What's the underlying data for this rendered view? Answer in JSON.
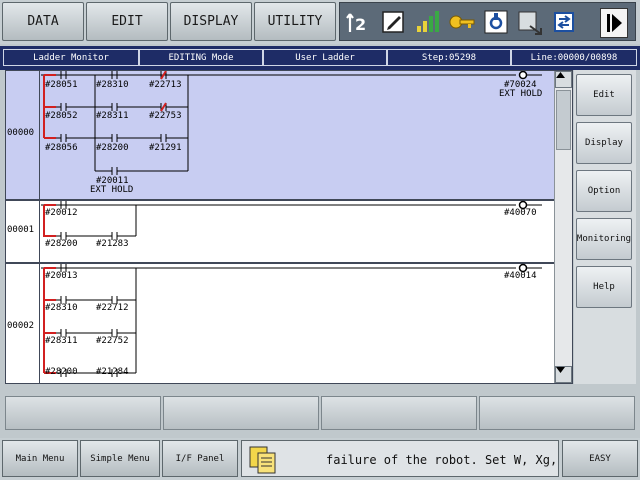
{
  "top_menu": {
    "items": [
      "DATA",
      "EDIT",
      "DISPLAY",
      "UTILITY"
    ]
  },
  "toolbar_icons": [
    "coordinate-toggle-icon",
    "edit-pencil-icon",
    "signal-strength-icon",
    "key-icon",
    "tool-icon",
    "exit-window-icon",
    "convert-icon",
    "next-page-icon"
  ],
  "status_bar": {
    "mode": "Ladder Monitor",
    "edit_mode": "EDITING Mode",
    "ladder_type": "User Ladder",
    "step": "Step:05298",
    "line": "Line:00000/00898"
  },
  "rungs": [
    {
      "number": "00000",
      "selected": true,
      "contacts": [
        "#28051",
        "#28310",
        "#22713",
        "#28052",
        "#28311",
        "#22753",
        "#28056",
        "#28200",
        "#21291",
        "#20011"
      ],
      "contact_note": "EXT HOLD",
      "output": "#70024",
      "output_note": "EXT HOLD"
    },
    {
      "number": "00001",
      "selected": false,
      "contacts": [
        "#20012",
        "#28200",
        "#21283"
      ],
      "output": "#40070"
    },
    {
      "number": "00002",
      "selected": false,
      "contacts": [
        "#20013",
        "#28310",
        "#22712",
        "#28311",
        "#22752",
        "#28200",
        "#21284"
      ],
      "output": "#40014"
    }
  ],
  "right_panel": [
    "Edit",
    "Display",
    "Option",
    "Monitoring",
    "Help"
  ],
  "function_keys": [
    "",
    "",
    "",
    ""
  ],
  "bottom_bar": {
    "main_menu": "Main Menu",
    "simple_menu": "Simple Menu",
    "if_panel": "I/F Panel",
    "message": "failure of the robot. Set W, Xg,",
    "easy": "EASY"
  },
  "colors": {
    "status_bg": "#1e2c66",
    "selected_rung_bg": "#c8cdf2",
    "red_wire": "#d22020",
    "nc_contact": "#d22020"
  }
}
